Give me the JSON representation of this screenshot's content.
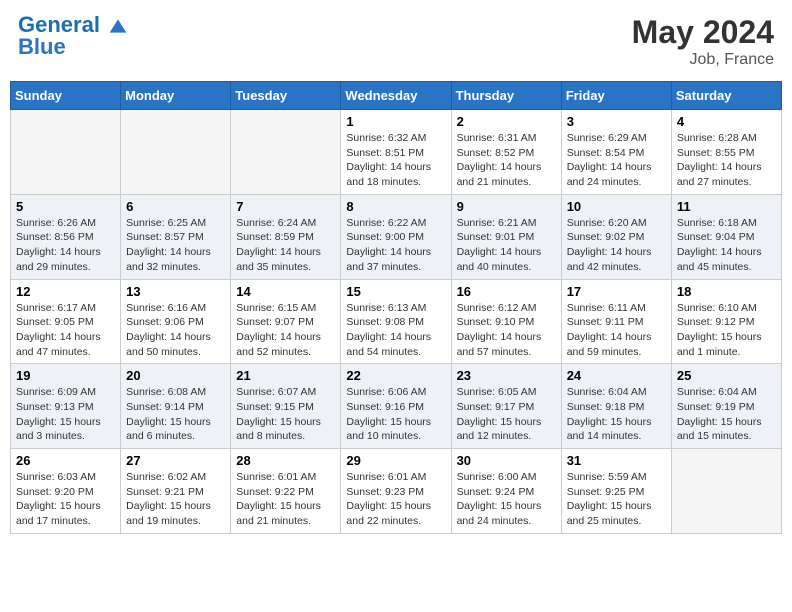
{
  "header": {
    "logo_line1": "General",
    "logo_line2": "Blue",
    "month_year": "May 2024",
    "location": "Job, France"
  },
  "days_of_week": [
    "Sunday",
    "Monday",
    "Tuesday",
    "Wednesday",
    "Thursday",
    "Friday",
    "Saturday"
  ],
  "weeks": [
    [
      {
        "day": "",
        "info": ""
      },
      {
        "day": "",
        "info": ""
      },
      {
        "day": "",
        "info": ""
      },
      {
        "day": "1",
        "info": "Sunrise: 6:32 AM\nSunset: 8:51 PM\nDaylight: 14 hours\nand 18 minutes."
      },
      {
        "day": "2",
        "info": "Sunrise: 6:31 AM\nSunset: 8:52 PM\nDaylight: 14 hours\nand 21 minutes."
      },
      {
        "day": "3",
        "info": "Sunrise: 6:29 AM\nSunset: 8:54 PM\nDaylight: 14 hours\nand 24 minutes."
      },
      {
        "day": "4",
        "info": "Sunrise: 6:28 AM\nSunset: 8:55 PM\nDaylight: 14 hours\nand 27 minutes."
      }
    ],
    [
      {
        "day": "5",
        "info": "Sunrise: 6:26 AM\nSunset: 8:56 PM\nDaylight: 14 hours\nand 29 minutes."
      },
      {
        "day": "6",
        "info": "Sunrise: 6:25 AM\nSunset: 8:57 PM\nDaylight: 14 hours\nand 32 minutes."
      },
      {
        "day": "7",
        "info": "Sunrise: 6:24 AM\nSunset: 8:59 PM\nDaylight: 14 hours\nand 35 minutes."
      },
      {
        "day": "8",
        "info": "Sunrise: 6:22 AM\nSunset: 9:00 PM\nDaylight: 14 hours\nand 37 minutes."
      },
      {
        "day": "9",
        "info": "Sunrise: 6:21 AM\nSunset: 9:01 PM\nDaylight: 14 hours\nand 40 minutes."
      },
      {
        "day": "10",
        "info": "Sunrise: 6:20 AM\nSunset: 9:02 PM\nDaylight: 14 hours\nand 42 minutes."
      },
      {
        "day": "11",
        "info": "Sunrise: 6:18 AM\nSunset: 9:04 PM\nDaylight: 14 hours\nand 45 minutes."
      }
    ],
    [
      {
        "day": "12",
        "info": "Sunrise: 6:17 AM\nSunset: 9:05 PM\nDaylight: 14 hours\nand 47 minutes."
      },
      {
        "day": "13",
        "info": "Sunrise: 6:16 AM\nSunset: 9:06 PM\nDaylight: 14 hours\nand 50 minutes."
      },
      {
        "day": "14",
        "info": "Sunrise: 6:15 AM\nSunset: 9:07 PM\nDaylight: 14 hours\nand 52 minutes."
      },
      {
        "day": "15",
        "info": "Sunrise: 6:13 AM\nSunset: 9:08 PM\nDaylight: 14 hours\nand 54 minutes."
      },
      {
        "day": "16",
        "info": "Sunrise: 6:12 AM\nSunset: 9:10 PM\nDaylight: 14 hours\nand 57 minutes."
      },
      {
        "day": "17",
        "info": "Sunrise: 6:11 AM\nSunset: 9:11 PM\nDaylight: 14 hours\nand 59 minutes."
      },
      {
        "day": "18",
        "info": "Sunrise: 6:10 AM\nSunset: 9:12 PM\nDaylight: 15 hours\nand 1 minute."
      }
    ],
    [
      {
        "day": "19",
        "info": "Sunrise: 6:09 AM\nSunset: 9:13 PM\nDaylight: 15 hours\nand 3 minutes."
      },
      {
        "day": "20",
        "info": "Sunrise: 6:08 AM\nSunset: 9:14 PM\nDaylight: 15 hours\nand 6 minutes."
      },
      {
        "day": "21",
        "info": "Sunrise: 6:07 AM\nSunset: 9:15 PM\nDaylight: 15 hours\nand 8 minutes."
      },
      {
        "day": "22",
        "info": "Sunrise: 6:06 AM\nSunset: 9:16 PM\nDaylight: 15 hours\nand 10 minutes."
      },
      {
        "day": "23",
        "info": "Sunrise: 6:05 AM\nSunset: 9:17 PM\nDaylight: 15 hours\nand 12 minutes."
      },
      {
        "day": "24",
        "info": "Sunrise: 6:04 AM\nSunset: 9:18 PM\nDaylight: 15 hours\nand 14 minutes."
      },
      {
        "day": "25",
        "info": "Sunrise: 6:04 AM\nSunset: 9:19 PM\nDaylight: 15 hours\nand 15 minutes."
      }
    ],
    [
      {
        "day": "26",
        "info": "Sunrise: 6:03 AM\nSunset: 9:20 PM\nDaylight: 15 hours\nand 17 minutes."
      },
      {
        "day": "27",
        "info": "Sunrise: 6:02 AM\nSunset: 9:21 PM\nDaylight: 15 hours\nand 19 minutes."
      },
      {
        "day": "28",
        "info": "Sunrise: 6:01 AM\nSunset: 9:22 PM\nDaylight: 15 hours\nand 21 minutes."
      },
      {
        "day": "29",
        "info": "Sunrise: 6:01 AM\nSunset: 9:23 PM\nDaylight: 15 hours\nand 22 minutes."
      },
      {
        "day": "30",
        "info": "Sunrise: 6:00 AM\nSunset: 9:24 PM\nDaylight: 15 hours\nand 24 minutes."
      },
      {
        "day": "31",
        "info": "Sunrise: 5:59 AM\nSunset: 9:25 PM\nDaylight: 15 hours\nand 25 minutes."
      },
      {
        "day": "",
        "info": ""
      }
    ]
  ]
}
